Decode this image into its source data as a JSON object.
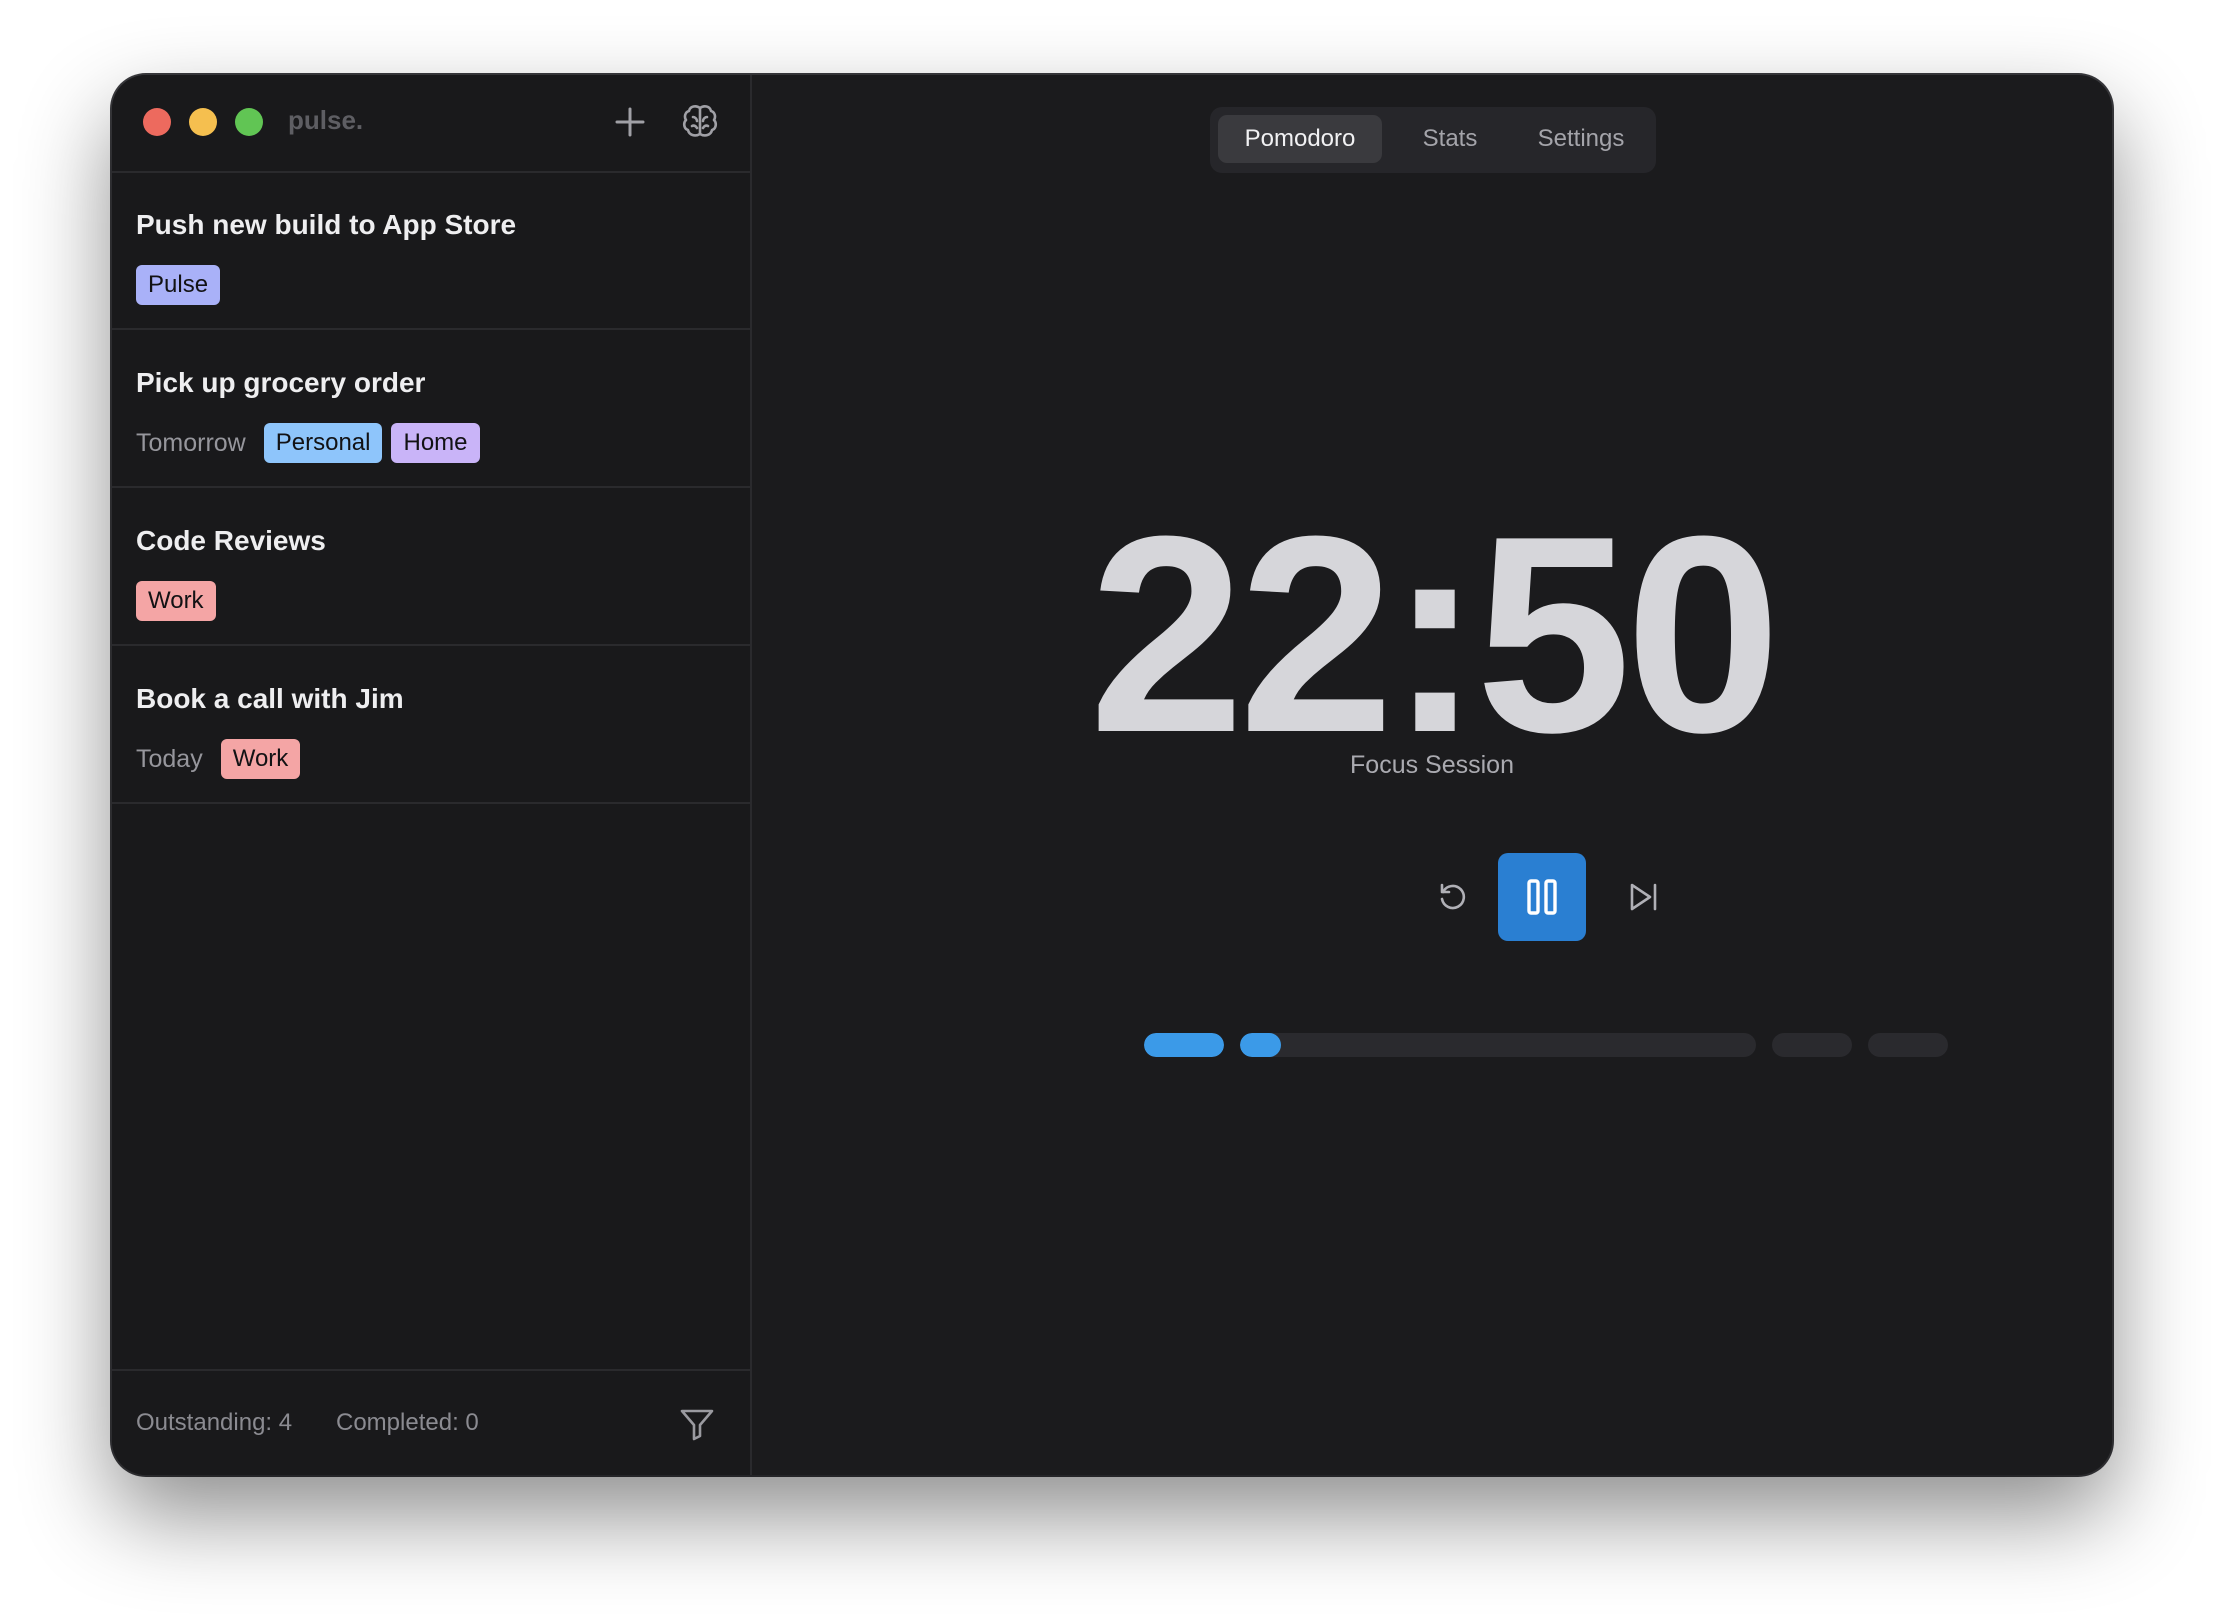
{
  "app": {
    "brand": "pulse."
  },
  "sidebar": {
    "tasks": [
      {
        "title": "Push new build to App Store",
        "due": "",
        "tags": [
          {
            "label": "Pulse",
            "color": "#a9b1f8"
          }
        ]
      },
      {
        "title": "Pick up grocery order",
        "due": "Tomorrow",
        "tags": [
          {
            "label": "Personal",
            "color": "#8ec5fb"
          },
          {
            "label": "Home",
            "color": "#c9b4f8"
          }
        ]
      },
      {
        "title": "Code Reviews",
        "due": "",
        "tags": [
          {
            "label": "Work",
            "color": "#f4a5a5"
          }
        ]
      },
      {
        "title": "Book a call with Jim",
        "due": "Today",
        "tags": [
          {
            "label": "Work",
            "color": "#f4a5a5"
          }
        ]
      }
    ],
    "footer": {
      "outstanding": "Outstanding: 4",
      "completed": "Completed: 0"
    }
  },
  "tabs": [
    {
      "label": "Pomodoro",
      "active": true
    },
    {
      "label": "Stats",
      "active": false
    },
    {
      "label": "Settings",
      "active": false
    }
  ],
  "timer": {
    "time": "22:50",
    "label": "Focus Session"
  },
  "icons": {
    "add": "plus-icon",
    "brain": "brain-icon",
    "filter": "filter-icon",
    "reset": "reset-icon",
    "pause": "pause-icon",
    "skip": "skip-forward-icon"
  },
  "progress": {
    "segments": [
      {
        "fill": 1.0
      },
      {
        "fill": 0.08
      },
      {
        "fill": 0
      },
      {
        "fill": 0
      }
    ]
  },
  "colors": {
    "accent": "#2a7fd2",
    "progress": "#3b9ae8"
  }
}
